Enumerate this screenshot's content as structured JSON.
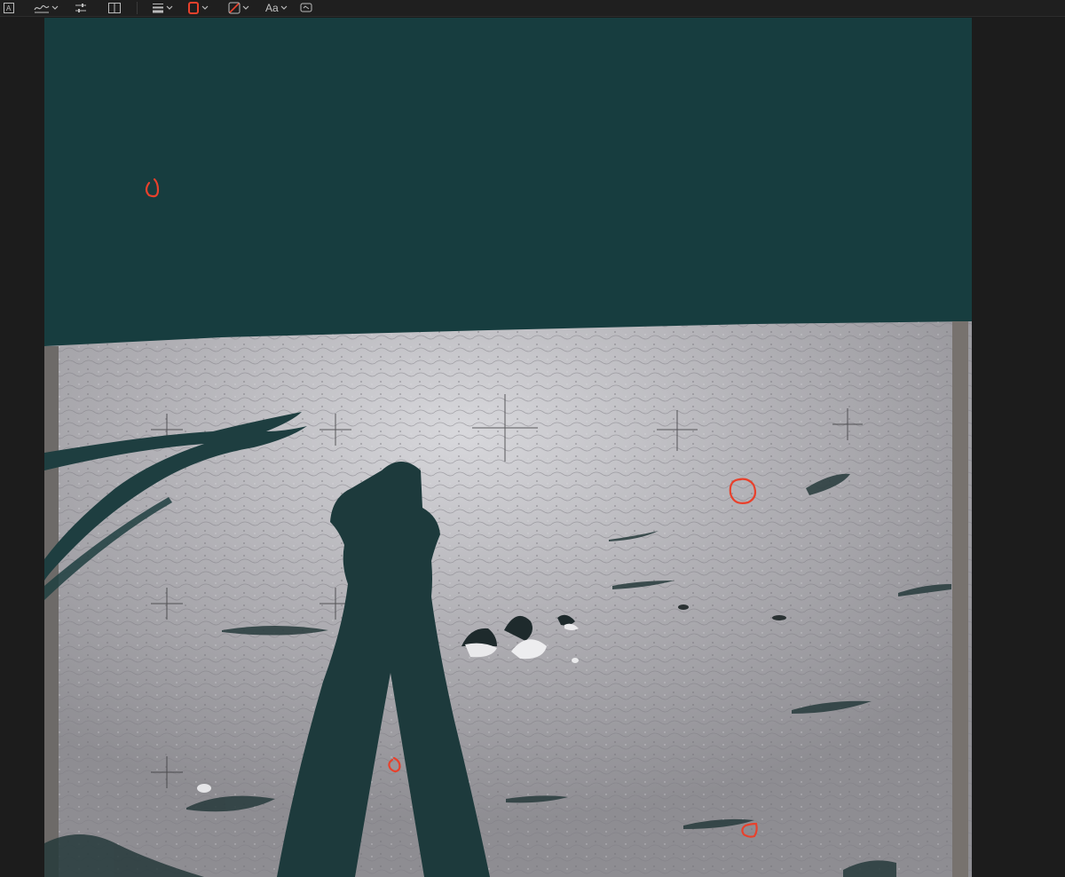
{
  "toolbar": {
    "items": [
      {
        "name": "text-box-tool",
        "icon": "text-box-icon"
      },
      {
        "name": "signature-tool",
        "icon": "signature-icon"
      },
      {
        "name": "adjust-tool",
        "icon": "sliders-icon"
      },
      {
        "name": "layout-tool",
        "icon": "columns-icon"
      },
      {
        "name": "line-weight-tool",
        "icon": "line-weight-icon"
      },
      {
        "name": "border-color-tool",
        "icon": "border-color-icon",
        "color": "#e8412c"
      },
      {
        "name": "fill-color-tool",
        "icon": "fill-color-icon",
        "color": "#e8412c"
      },
      {
        "name": "font-tool",
        "icon": "font-icon",
        "label": "Aa"
      },
      {
        "name": "sign-tool",
        "icon": "sign-icon"
      }
    ]
  },
  "photo": {
    "sky_color": "#173d3f",
    "ground_color": "#a9a8ac",
    "shadow_color": "#1d3a3c",
    "annotation_color": "#e8412c"
  }
}
